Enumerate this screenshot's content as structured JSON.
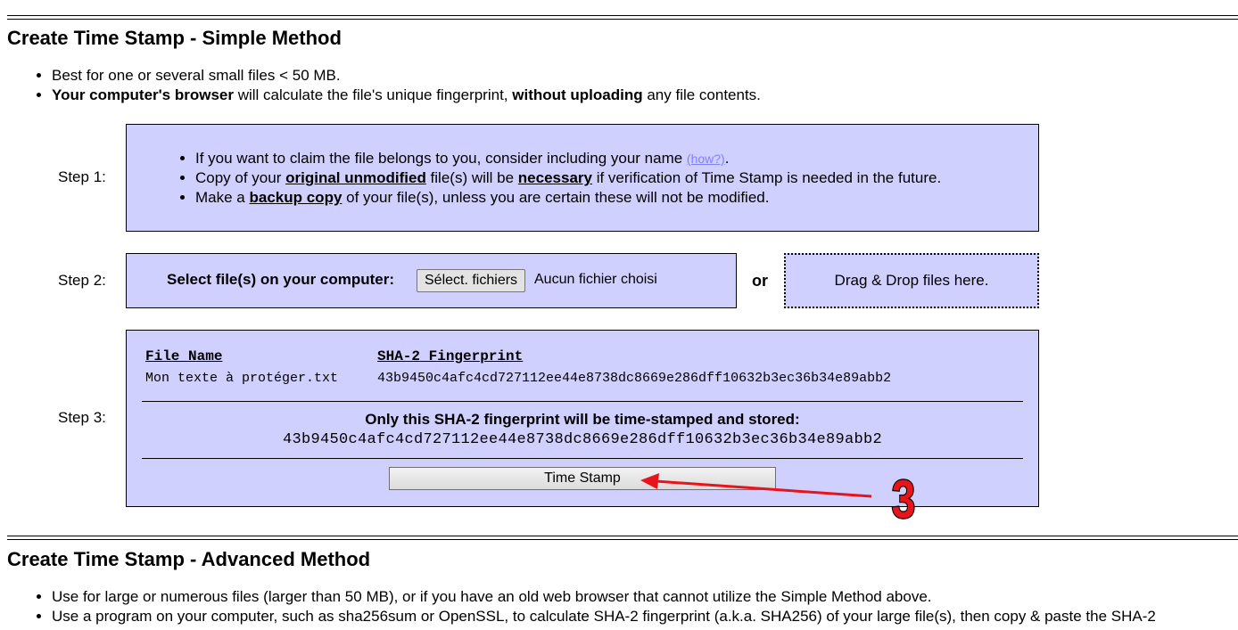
{
  "simple": {
    "title": "Create Time Stamp - Simple Method",
    "bullet1": "Best for one or several small files < 50 MB.",
    "bullet2_bold1": "Your computer's browser",
    "bullet2_text1": " will calculate the file's unique fingerprint, ",
    "bullet2_bold2": "without uploading",
    "bullet2_text2": " any file contents."
  },
  "step1": {
    "label": "Step 1:",
    "line1": "If you want to claim the file belongs to you, consider including your name ",
    "how_link": "(how?)",
    "line1_end": ".",
    "line2_a": "Copy of your ",
    "line2_b": "original unmodified",
    "line2_c": " file(s) will be ",
    "line2_d": "necessary",
    "line2_e": " if verification of Time Stamp is needed in the future.",
    "line3_a": "Make a ",
    "line3_b": "backup copy",
    "line3_c": " of your file(s), unless you are certain these will not be modified."
  },
  "step2": {
    "label": "Step 2:",
    "select_label": "Select file(s) on your computer:",
    "button": "Sélect. fichiers",
    "no_file": "Aucun fichier choisi",
    "or": "or",
    "dropzone": "Drag & Drop files here."
  },
  "step3": {
    "label": "Step 3:",
    "col_file": "File Name",
    "col_hash": "SHA-2 Fingerprint",
    "file_name": "Mon texte à protéger.txt",
    "file_hash": "43b9450c4afc4cd727112ee44e8738dc8669e286dff10632b3ec36b34e89abb2",
    "only_text": "Only this SHA-2 fingerprint will be time-stamped and stored:",
    "final_hash": "43b9450c4afc4cd727112ee44e8738dc8669e286dff10632b3ec36b34e89abb2",
    "button": "Time Stamp"
  },
  "annotation": {
    "number": "3",
    "color": "#e8141c"
  },
  "advanced": {
    "title": "Create Time Stamp - Advanced Method",
    "bullet1": "Use for large or numerous files (larger than 50 MB), or if you have an old web browser that cannot utilize the Simple Method above.",
    "bullet2": "Use a program on your computer, such as sha256sum or OpenSSL, to calculate SHA-2 fingerprint (a.k.a. SHA256) of your large file(s), then copy & paste the SHA-2"
  },
  "colors": {
    "box_bg": "#d0d0ff",
    "link": "#8080ff"
  }
}
